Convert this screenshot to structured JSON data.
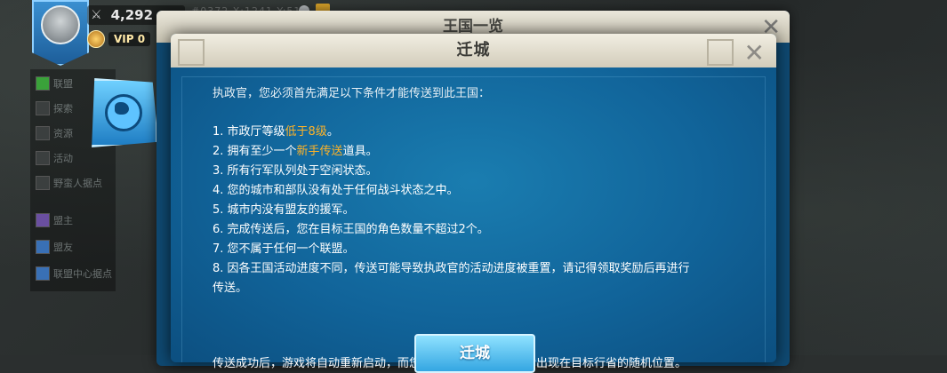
{
  "hud": {
    "power": "4,292",
    "vip": "VIP 0",
    "coords": "#0372 X:1241 Y:512"
  },
  "side_panel": {
    "items": [
      "联盟",
      "探索",
      "资源",
      "活动",
      "野蛮人据点"
    ],
    "roles": [
      "盟主",
      "盟友",
      "联盟中心据点"
    ]
  },
  "back_dialog": {
    "title": "王国一览",
    "close": "✕"
  },
  "dialog": {
    "title": "迁城",
    "close": "✕",
    "intro": "执政官，您必须首先满足以下条件才能传送到此王国：",
    "conditions": [
      {
        "prefix": "1. 市政厅等级",
        "highlight": "低于8级",
        "suffix": "。"
      },
      {
        "prefix": "2. 拥有至少一个",
        "highlight": "新手传送",
        "suffix": "道具。"
      },
      {
        "prefix": "3. 所有行军队列处于空闲状态。",
        "highlight": "",
        "suffix": ""
      },
      {
        "prefix": "4. 您的城市和部队没有处于任何战斗状态之中。",
        "highlight": "",
        "suffix": ""
      },
      {
        "prefix": "5. 城市内没有盟友的援军。",
        "highlight": "",
        "suffix": ""
      },
      {
        "prefix": "6. 完成传送后，您在目标王国的角色数量不超过2个。",
        "highlight": "",
        "suffix": ""
      },
      {
        "prefix": "7. 您不属于任何一个联盟。",
        "highlight": "",
        "suffix": ""
      },
      {
        "prefix": "8. 因各王国活动进度不同，传送可能导致执政官的活动进度被重置，请记得领取奖励后再进行",
        "highlight": "",
        "suffix": ""
      },
      {
        "prefix": "传送。",
        "highlight": "",
        "suffix": ""
      }
    ],
    "footer": "传送成功后，游戏将自动重新启动，而您的城市会在进入游戏后出现在目标行省的随机位置。",
    "button": "迁城"
  }
}
